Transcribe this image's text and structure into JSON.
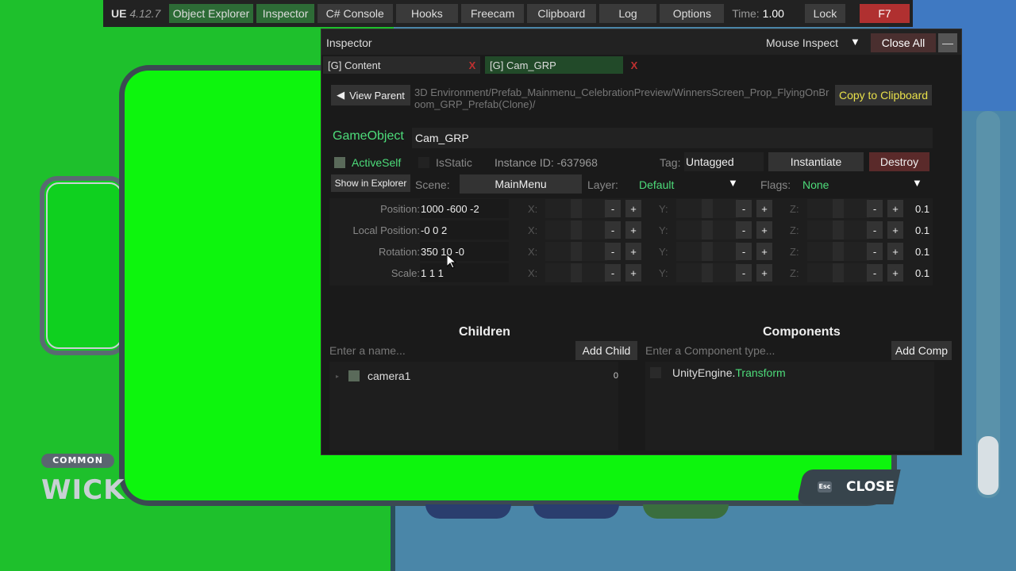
{
  "topbar": {
    "brand": "UE",
    "version": "4.12.7",
    "tabs": [
      {
        "label": "Object Explorer"
      },
      {
        "label": "Inspector"
      },
      {
        "label": "C# Console"
      },
      {
        "label": "Hooks"
      },
      {
        "label": "Freecam"
      },
      {
        "label": "Clipboard"
      },
      {
        "label": "Log"
      },
      {
        "label": "Options"
      }
    ],
    "time_label": "Time:",
    "time_value": "1.00",
    "lock_label": "Lock",
    "hotkey_label": "F7"
  },
  "inspector": {
    "title": "Inspector",
    "mouse_inspect": "Mouse Inspect",
    "close_all": "Close All",
    "minimize": "—",
    "tabs": [
      {
        "label": "[G] Content",
        "close": "X"
      },
      {
        "label": "[G] Cam_GRP",
        "close": "X"
      }
    ],
    "view_parent": "View Parent",
    "path": "3D Environment/Prefab_Mainmenu_CelebrationPreview/WinnersScreen_Prop_FlyingOnBroom_GRP_Prefab(Clone)/",
    "copy_clipboard": "Copy to Clipboard",
    "gameobject_label": "GameObject",
    "gameobject_name": "Cam_GRP",
    "active_self": "ActiveSelf",
    "is_static": "IsStatic",
    "instance_id_label": "Instance ID:",
    "instance_id": "-637968",
    "tag_label": "Tag:",
    "tag_value": "Untagged",
    "instantiate": "Instantiate",
    "destroy": "Destroy",
    "show_in_explorer": "Show in Explorer",
    "scene_label": "Scene:",
    "scene_value": "MainMenu",
    "layer_label": "Layer:",
    "layer_value": "Default",
    "flags_label": "Flags:",
    "flags_value": "None",
    "transform": [
      {
        "label": "Position:",
        "value": "1000 -600 -2",
        "step": "0.1"
      },
      {
        "label": "Local Position:",
        "value": "-0 0 2",
        "step": "0.1"
      },
      {
        "label": "Rotation:",
        "value": "350 10 -0",
        "step": "0.1"
      },
      {
        "label": "Scale:",
        "value": "1 1 1",
        "step": "0.1"
      }
    ],
    "axes": [
      "X:",
      "Y:",
      "Z:"
    ],
    "minus": "-",
    "plus": "+",
    "children_title": "Children",
    "children_placeholder": "Enter a name...",
    "add_child": "Add Child",
    "children": [
      {
        "name": "camera1",
        "count": "0"
      }
    ],
    "components_title": "Components",
    "components_placeholder": "Enter a Component type...",
    "add_comp": "Add Comp",
    "components": [
      {
        "namespace": "UnityEngine.",
        "type": "Transform"
      }
    ]
  },
  "game": {
    "tag": "COMMON",
    "title_partial": "WICK",
    "close_label": "CLOSE",
    "esc_label": "Esc"
  }
}
